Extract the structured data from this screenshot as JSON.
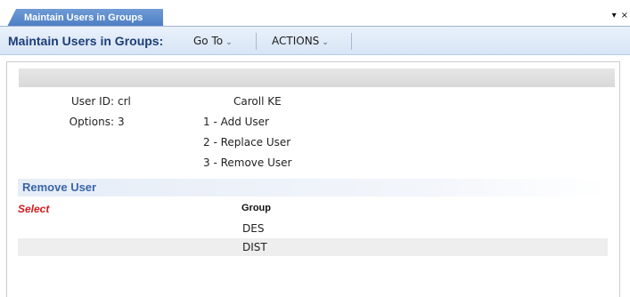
{
  "tab": {
    "title": "Maintain Users in Groups",
    "controls": [
      "▾",
      "×"
    ]
  },
  "toolbar": {
    "title": "Maintain Users in Groups:",
    "menus": [
      {
        "label": "Go To",
        "caret": "⌄"
      },
      {
        "label": "ACTIONS",
        "caret": "⌄"
      }
    ]
  },
  "form": {
    "user_id_label": "User ID:",
    "user_id_value": "crl",
    "user_name": "Caroll KE",
    "options_label": "Options:",
    "options_value": "3",
    "option_items": [
      "1 - Add User",
      "2 - Replace User",
      "3 - Remove User"
    ]
  },
  "section": {
    "title": "Remove User",
    "select_label": "Select",
    "column_header": "Group",
    "rows": [
      {
        "group": "DES"
      },
      {
        "group": "DIST"
      }
    ]
  }
}
